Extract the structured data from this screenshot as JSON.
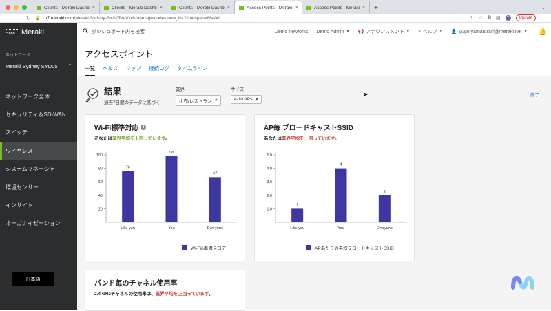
{
  "browser": {
    "tabs": [
      {
        "title": "Clients - Meraki Dashboard",
        "active": false
      },
      {
        "title": "Clients - Meraki Dashboard",
        "active": false
      },
      {
        "title": "Clients - Meraki Dashboard",
        "active": false
      },
      {
        "title": "Access Points - Meraki Dashb",
        "active": true
      },
      {
        "title": "Access Points - Meraki Dashbo",
        "active": false
      }
    ],
    "new_tab": "+",
    "url_host": "n7.meraki.com",
    "url_path": "/Meraki-Sydney-SY/n/RzeVxch/manage/nodes/new_list?timespan=86400",
    "avatar": "Y",
    "update_label": "Update"
  },
  "sidebar": {
    "brand_small": "cisco",
    "brand": "Meraki",
    "network_label": "ネットワーク",
    "network_name": "Meraki Sydney SYD05",
    "items": [
      {
        "label": "ネットワーク全体",
        "active": false
      },
      {
        "label": "セキュリティ＆SD-WAN",
        "active": false
      },
      {
        "label": "スイッチ",
        "active": false
      },
      {
        "label": "ワイヤレス",
        "active": true
      },
      {
        "label": "システムマネージャ",
        "active": false
      },
      {
        "label": "環境センサー",
        "active": false
      },
      {
        "label": "インサイト",
        "active": false
      },
      {
        "label": "オーガナイゼーション",
        "active": false
      }
    ],
    "language_button": "日本語"
  },
  "topbar": {
    "search_placeholder": "ダッシュボード内を検索",
    "demo_networks": "Demo networks",
    "demo_admin": "Demo Admin",
    "announcements": "アナウンスメント",
    "help": "ヘルプ",
    "user_email": "yugo.yamautsuri@meraki.net"
  },
  "page": {
    "title": "アクセスポイント",
    "tabs": [
      {
        "label": "一覧",
        "active": true
      },
      {
        "label": "ヘルス",
        "active": false
      },
      {
        "label": "マップ",
        "active": false
      },
      {
        "label": "接続ログ",
        "active": false
      },
      {
        "label": "タイムライン",
        "active": false
      }
    ]
  },
  "summary": {
    "title": "結果",
    "subtitle": "過去7日間のデータに基づく",
    "industry_label": "業界",
    "industry_value": "小売/レストラン",
    "size_label": "サイズ",
    "size_value": "4-10 APs",
    "end_link": "終了"
  },
  "cards": {
    "wifi": {
      "title": "Wi-Fi標準対応",
      "sub_prefix": "あなたは",
      "sub_highlight": "業界平均を上回っています",
      "sub_suffix": "。",
      "legend": "Wi-Fi6準備スコア"
    },
    "ssid": {
      "title": "AP毎 ブロードキャストSSID",
      "sub_prefix": "あなたは",
      "sub_highlight": "業界平均を上回っています",
      "sub_suffix": "。",
      "legend": "APあたりの平均ブロードキャストSSID"
    },
    "band": {
      "title": "バンド毎のチャネル使用率",
      "sub_prefix": "2.4 GHzチャネルの使用率は、",
      "sub_highlight": "業界平均を上回っています",
      "sub_suffix": "。"
    }
  },
  "chart_data": [
    {
      "type": "bar",
      "categories": [
        "Like you",
        "You",
        "Everyone"
      ],
      "values": [
        76,
        98,
        67
      ],
      "ylim": [
        0,
        100
      ],
      "yticks": [
        20,
        40,
        60,
        80,
        100
      ],
      "grid": false,
      "color": "#3d37a1"
    },
    {
      "type": "bar",
      "categories": [
        "Like you",
        "You",
        "Everyone"
      ],
      "values": [
        1,
        4,
        2
      ],
      "ylim": [
        0,
        5
      ],
      "yticks": [
        "1.0",
        "2.0",
        "3.0",
        "4.0",
        "5.0"
      ],
      "grid": false,
      "color": "#3d37a1"
    }
  ]
}
